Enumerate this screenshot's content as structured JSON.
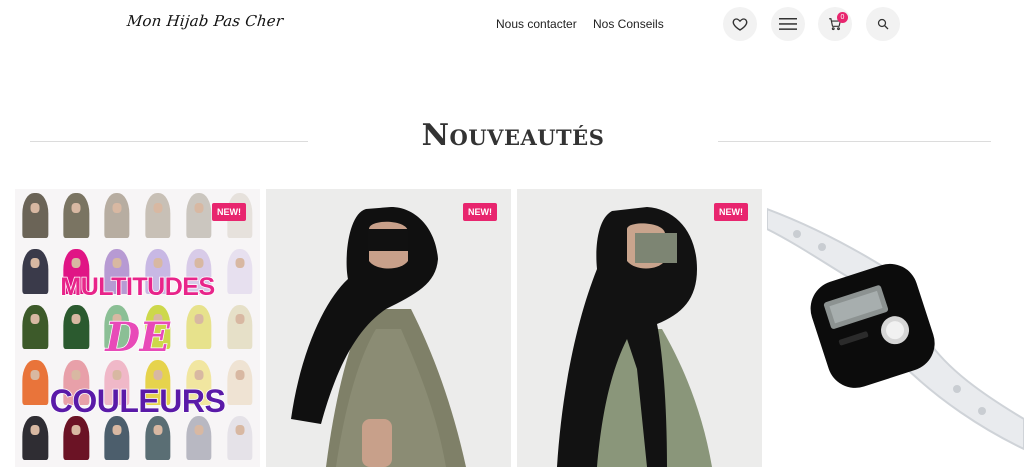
{
  "header": {
    "logo": "Mon Hijab Pas Cher",
    "nav": [
      "Nous contacter",
      "Nos Conseils"
    ],
    "icons": [
      "heart-icon",
      "menu-icon",
      "cart-icon",
      "search-icon"
    ],
    "cart_count": "0"
  },
  "section": {
    "title": "Nouveautés"
  },
  "products": [
    {
      "badge": "NEW!",
      "overlay_lines": [
        "MULTITUDES",
        "DE",
        "COULEURS"
      ]
    },
    {
      "badge": "NEW!"
    },
    {
      "badge": "NEW!"
    },
    {}
  ],
  "colors": {
    "accent": "#e8256e",
    "text": "#222222",
    "line": "#dcdcdc"
  }
}
